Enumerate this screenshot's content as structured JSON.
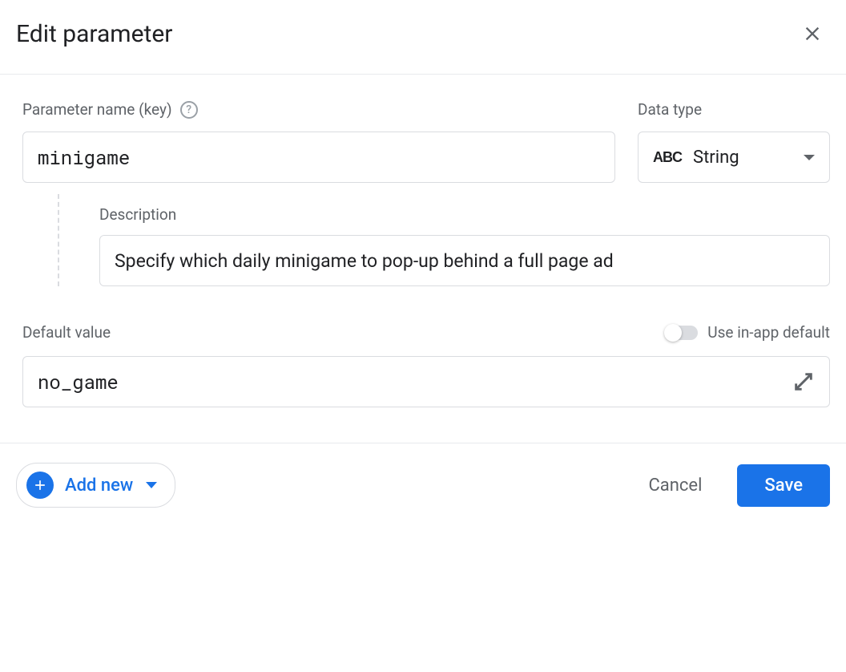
{
  "dialog": {
    "title": "Edit parameter"
  },
  "param": {
    "name_label": "Parameter name (key)",
    "name_value": "minigame"
  },
  "datatype": {
    "label": "Data type",
    "icon_text": "ABC",
    "value": "String"
  },
  "description": {
    "label": "Description",
    "value": "Specify which daily minigame to pop-up behind a full page ad"
  },
  "default": {
    "label": "Default value",
    "toggle_label": "Use in-app default",
    "toggle_state": false,
    "value": "no_game"
  },
  "footer": {
    "add_new": "Add new",
    "cancel": "Cancel",
    "save": "Save"
  }
}
